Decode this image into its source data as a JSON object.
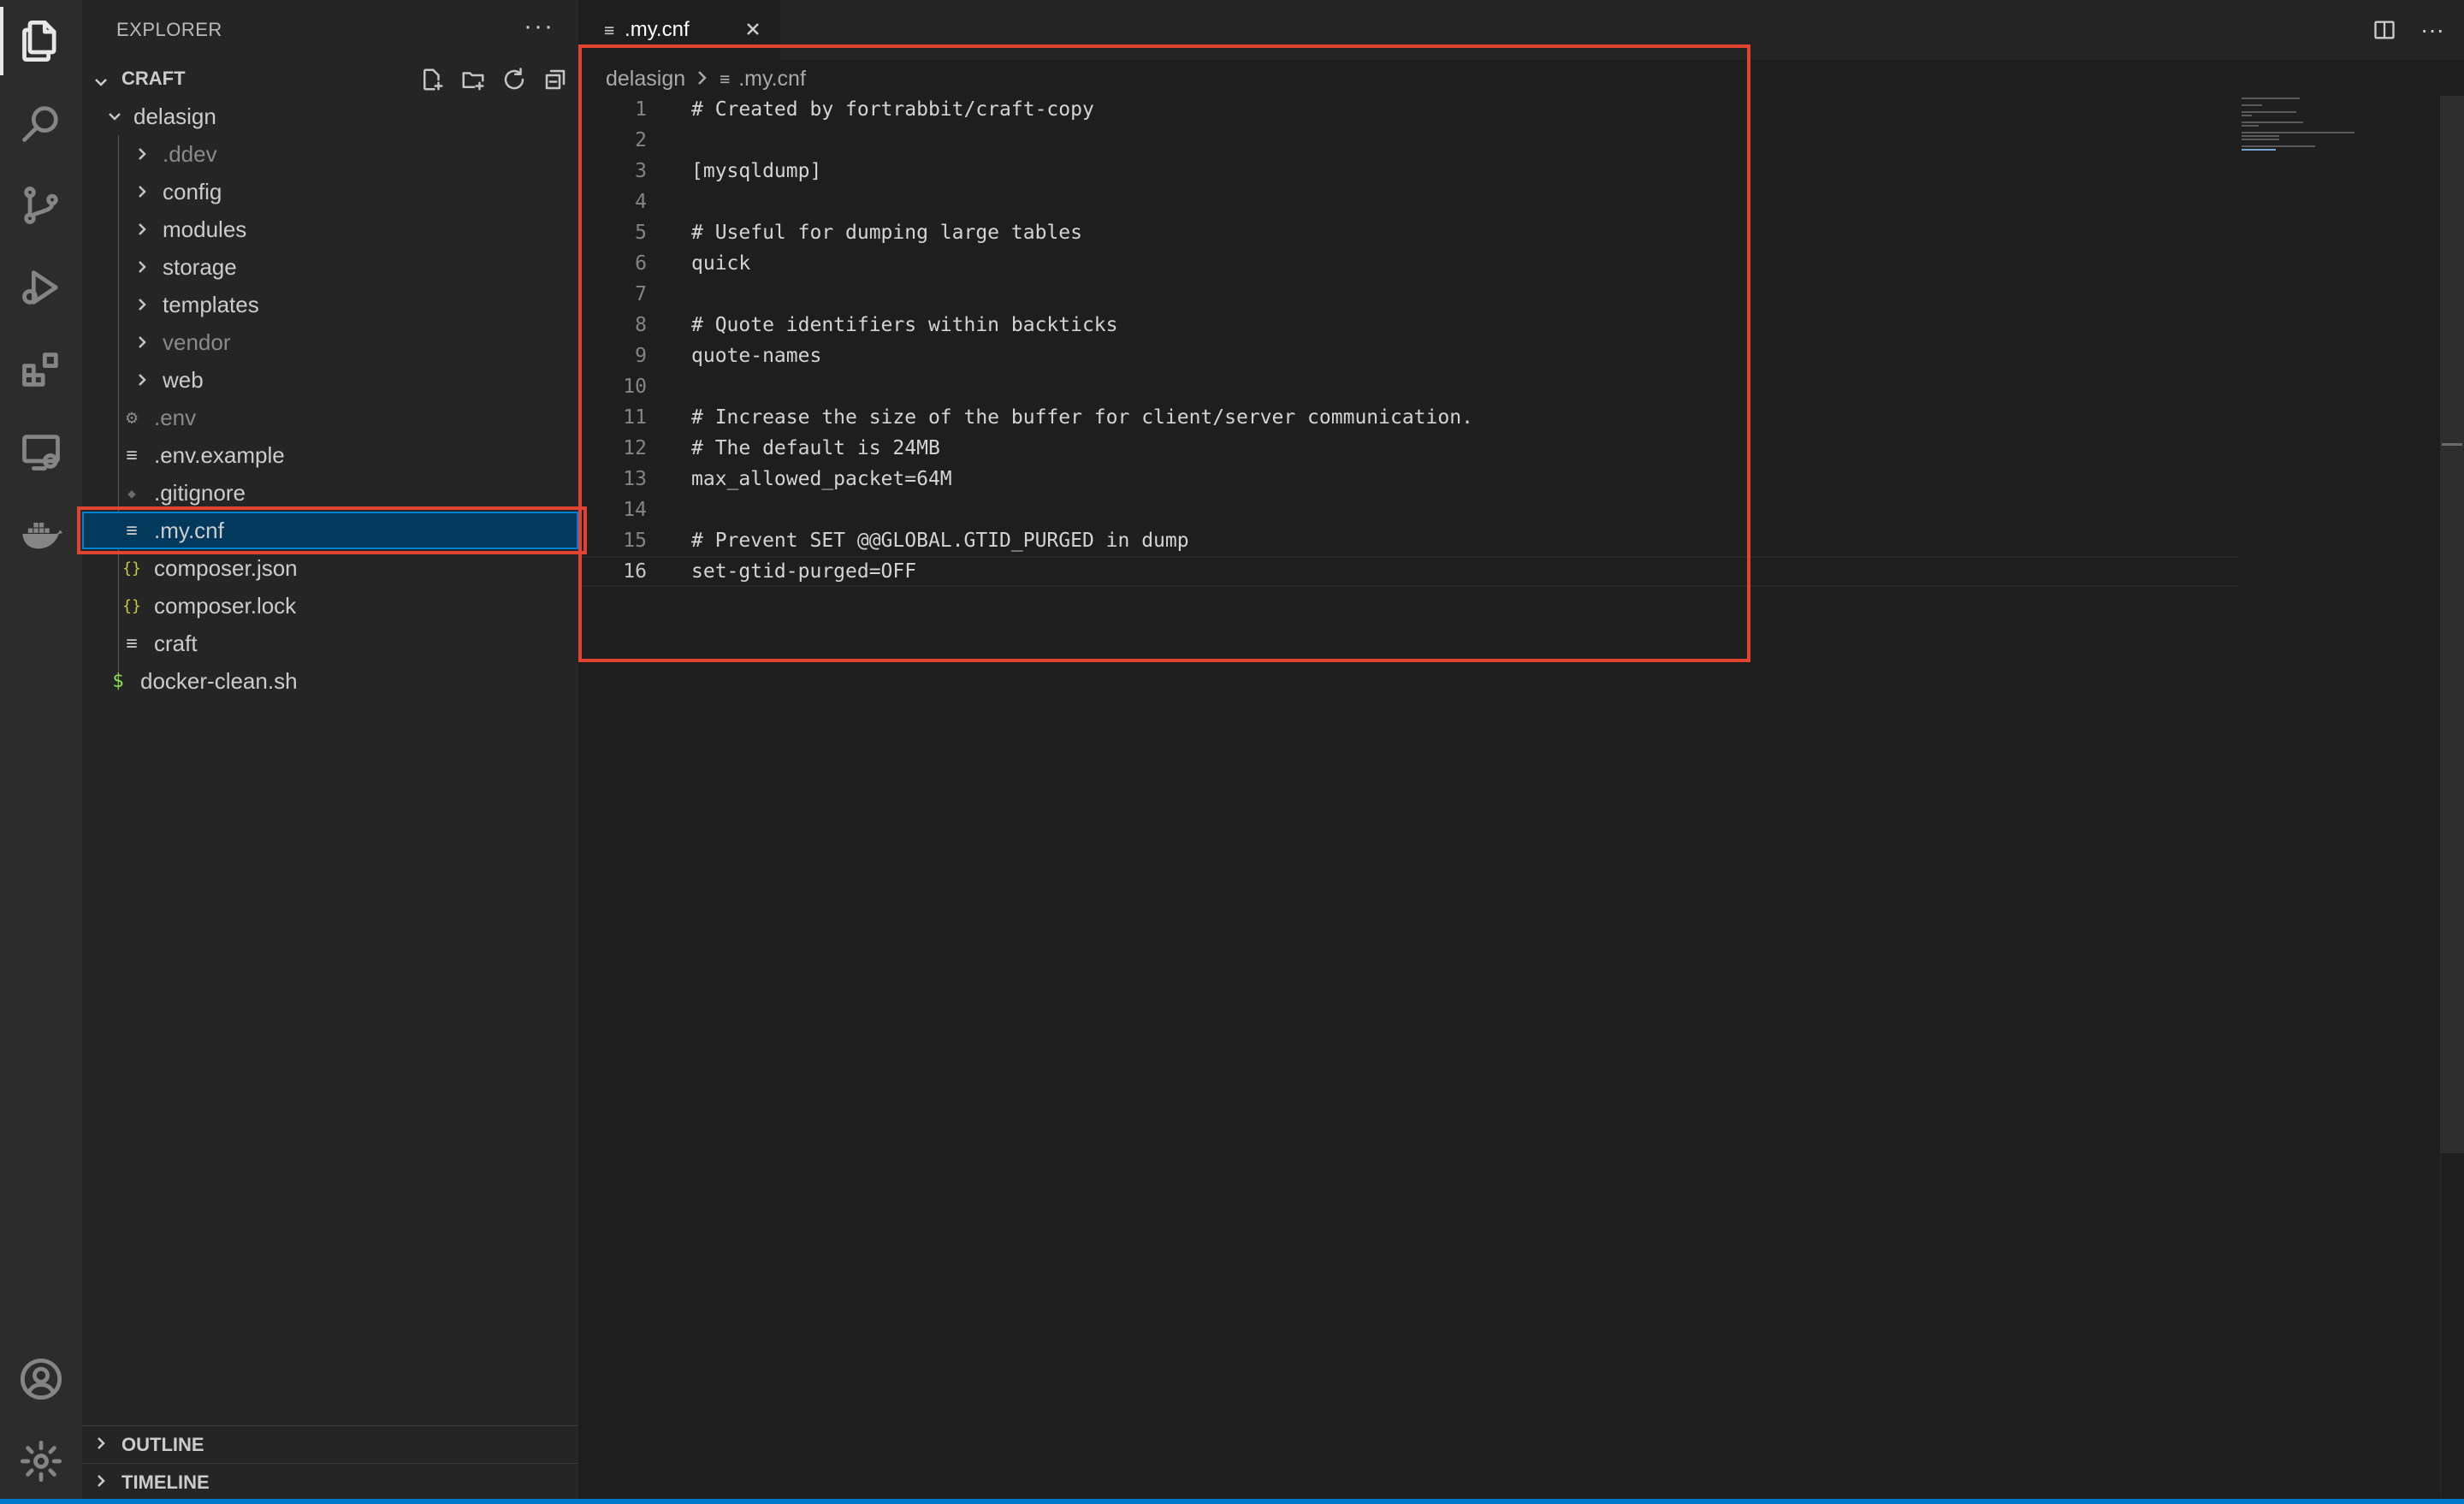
{
  "activity_bar": {
    "icons": [
      "explorer-icon",
      "search-icon",
      "source-control-icon",
      "run-debug-icon",
      "extensions-icon",
      "remote-explorer-icon",
      "docker-icon",
      "account-icon",
      "settings-gear-icon"
    ]
  },
  "sidebar": {
    "title": "EXPLORER",
    "more": "···",
    "section": "CRAFT",
    "tree": [
      {
        "label": "delasign",
        "icon": "",
        "kind": "folder-open"
      },
      {
        "label": ".ddev",
        "icon": "",
        "kind": "folder",
        "dim": true
      },
      {
        "label": "config",
        "icon": "",
        "kind": "folder"
      },
      {
        "label": "modules",
        "icon": "",
        "kind": "folder"
      },
      {
        "label": "storage",
        "icon": "",
        "kind": "folder"
      },
      {
        "label": "templates",
        "icon": "",
        "kind": "folder"
      },
      {
        "label": "vendor",
        "icon": "",
        "kind": "folder",
        "dim": true
      },
      {
        "label": "web",
        "icon": "",
        "kind": "folder"
      },
      {
        "label": ".env",
        "icon": "⚙",
        "kind": "file",
        "dim": true
      },
      {
        "label": ".env.example",
        "icon": "≡",
        "kind": "file"
      },
      {
        "label": ".gitignore",
        "icon": "◆",
        "kind": "file"
      },
      {
        "label": ".my.cnf",
        "icon": "≡",
        "kind": "file",
        "selected": true
      },
      {
        "label": "composer.json",
        "icon": "{}",
        "kind": "file"
      },
      {
        "label": "composer.lock",
        "icon": "{}",
        "kind": "file"
      },
      {
        "label": "craft",
        "icon": "≡",
        "kind": "file"
      },
      {
        "label": "docker-clean.sh",
        "icon": "$",
        "kind": "file"
      }
    ],
    "outline": "OUTLINE",
    "timeline": "TIMELINE"
  },
  "tab": {
    "label": ".my.cnf",
    "icon": "≡"
  },
  "breadcrumb": {
    "folder": "delasign",
    "file": ".my.cnf",
    "icon": "≡"
  },
  "editor": {
    "current_line": 16,
    "lines": [
      "# Created by fortrabbit/craft-copy",
      "",
      "[mysqldump]",
      "",
      "# Useful for dumping large tables",
      "quick",
      "",
      "# Quote identifiers within backticks",
      "quote-names",
      "",
      "# Increase the size of the buffer for client/server communication.",
      "# The default is 24MB",
      "max_allowed_packet=64M",
      "",
      "# Prevent SET @@GLOBAL.GTID_PURGED in dump",
      "set-gtid-purged=OFF"
    ]
  },
  "colors": {
    "highlight": "#e0432f",
    "selection": "#04395e",
    "accent": "#007acc"
  }
}
